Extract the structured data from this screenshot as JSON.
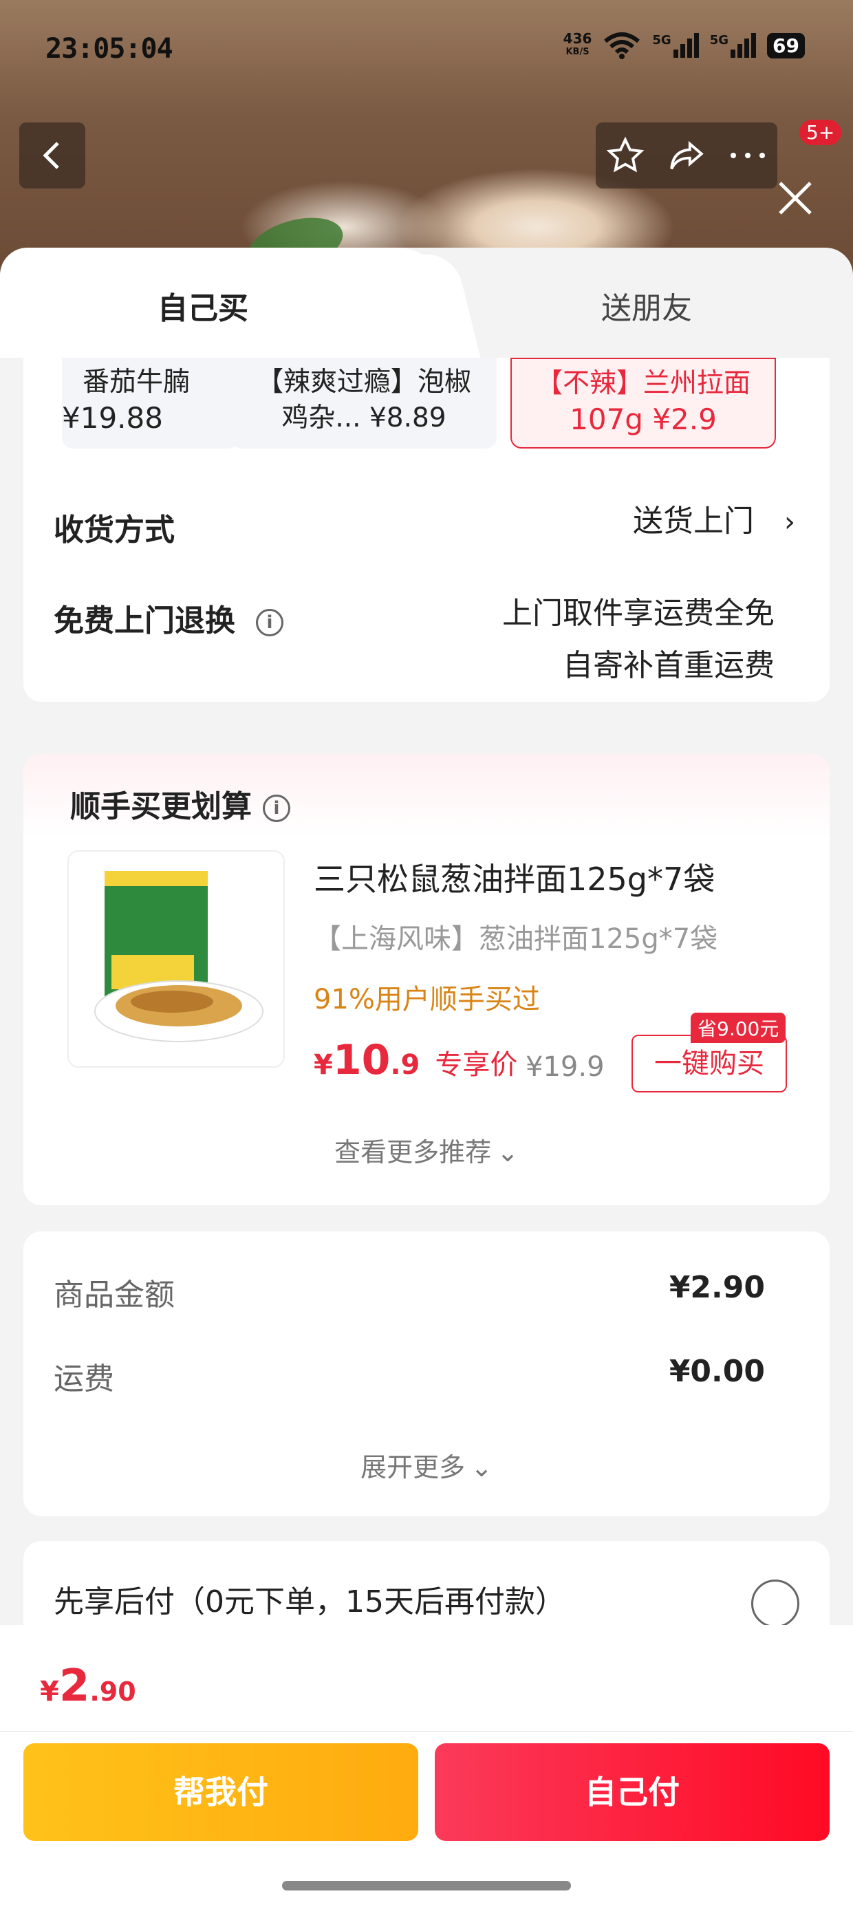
{
  "status_bar": {
    "time": "23:05:04",
    "net_speed": "436",
    "net_unit": "KB/S",
    "signal1": "5G",
    "signal2": "5G",
    "battery": "69"
  },
  "header": {
    "badge_count": "5+",
    "icons": [
      "back-icon",
      "star-icon",
      "share-icon",
      "more-icon",
      "close-icon"
    ]
  },
  "tabs": [
    {
      "label": "自己买",
      "active": true
    },
    {
      "label": "送朋友",
      "active": false
    }
  ],
  "specs": [
    {
      "line1": "番茄牛腩",
      "line2": "¥19.88"
    },
    {
      "line1": "【辣爽过瘾】泡椒",
      "line2": "鸡杂... ¥8.89"
    },
    {
      "line1": "【不辣】兰州拉面",
      "line2": "107g ¥2.9",
      "selected": true
    }
  ],
  "delivery": {
    "label": "收货方式",
    "value": "送货上门"
  },
  "return": {
    "label": "免费上门退换",
    "line1": "上门取件享运费全免",
    "line2": "自寄补首重运费"
  },
  "bundle": {
    "title": "顺手买更划算",
    "product_title": "三只松鼠葱油拌面125g*7袋",
    "product_sub": "【上海风味】葱油拌面125g*7袋",
    "stat": "91%用户顺手买过",
    "price_symbol": "¥",
    "price_int": "10",
    "price_dec": ".9",
    "price_tag": "专享价",
    "old_price": "¥19.9",
    "buy_label": "一键购买",
    "save_label": "省9.00元",
    "more_label": "查看更多推荐"
  },
  "fees": {
    "goods_label": "商品金额",
    "goods_value": "¥2.90",
    "shipping_label": "运费",
    "shipping_value": "¥0.00",
    "expand_label": "展开更多"
  },
  "paylater": {
    "label": "先享后付（0元下单，15天后再付款）"
  },
  "footer": {
    "total_symbol": "¥",
    "total_int": "2",
    "total_dec": ".90",
    "help_label": "帮我付",
    "self_label": "自己付"
  },
  "colors": {
    "accent": "#e8283c",
    "yellow": "#ffb80f",
    "orange_text": "#d98415"
  }
}
